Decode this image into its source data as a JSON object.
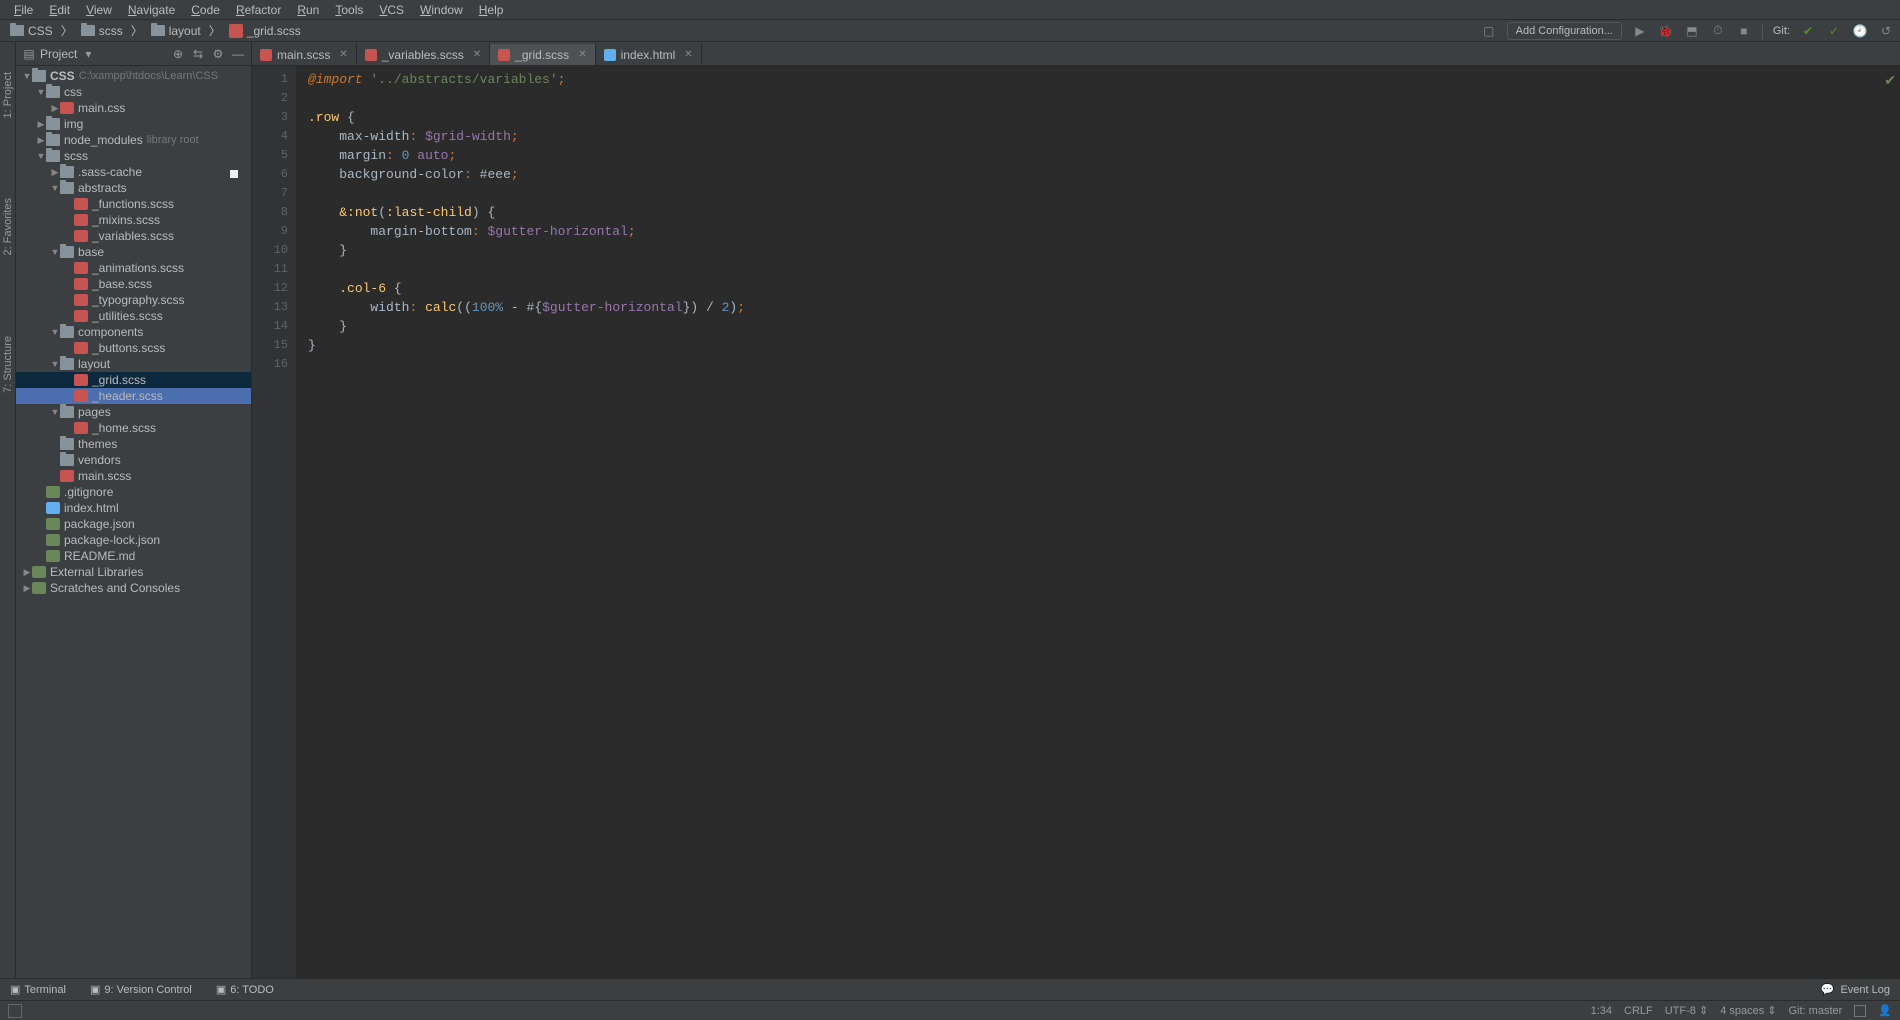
{
  "menu": [
    "File",
    "Edit",
    "View",
    "Navigate",
    "Code",
    "Refactor",
    "Run",
    "Tools",
    "VCS",
    "Window",
    "Help"
  ],
  "breadcrumb": [
    {
      "icon": "folder",
      "label": "CSS"
    },
    {
      "icon": "folder",
      "label": "scss"
    },
    {
      "icon": "folder",
      "label": "layout"
    },
    {
      "icon": "scss",
      "label": "_grid.scss"
    }
  ],
  "run_config": {
    "add": "Add Configuration..."
  },
  "vcs_label": "Git:",
  "sidebar": {
    "title": "Project",
    "tree": [
      {
        "d": 0,
        "arrow": "▼",
        "icon": "folder",
        "label": "CSS",
        "suffix": "C:\\xampp\\htdocs\\Learn\\CSS",
        "bold": true
      },
      {
        "d": 1,
        "arrow": "▼",
        "icon": "folder",
        "label": "css"
      },
      {
        "d": 2,
        "arrow": "▶",
        "icon": "css",
        "label": "main.css"
      },
      {
        "d": 1,
        "arrow": "▶",
        "icon": "folder",
        "label": "img"
      },
      {
        "d": 1,
        "arrow": "▶",
        "icon": "folder",
        "label": "node_modules",
        "suffix": "library root"
      },
      {
        "d": 1,
        "arrow": "▼",
        "icon": "folder",
        "label": "scss"
      },
      {
        "d": 2,
        "arrow": "▶",
        "icon": "folder",
        "label": ".sass-cache"
      },
      {
        "d": 2,
        "arrow": "▼",
        "icon": "folder",
        "label": "abstracts"
      },
      {
        "d": 3,
        "arrow": "",
        "icon": "scss",
        "label": "_functions.scss"
      },
      {
        "d": 3,
        "arrow": "",
        "icon": "scss",
        "label": "_mixins.scss"
      },
      {
        "d": 3,
        "arrow": "",
        "icon": "scss",
        "label": "_variables.scss"
      },
      {
        "d": 2,
        "arrow": "▼",
        "icon": "folder",
        "label": "base"
      },
      {
        "d": 3,
        "arrow": "",
        "icon": "scss",
        "label": "_animations.scss"
      },
      {
        "d": 3,
        "arrow": "",
        "icon": "scss",
        "label": "_base.scss"
      },
      {
        "d": 3,
        "arrow": "",
        "icon": "scss",
        "label": "_typography.scss"
      },
      {
        "d": 3,
        "arrow": "",
        "icon": "scss",
        "label": "_utilities.scss"
      },
      {
        "d": 2,
        "arrow": "▼",
        "icon": "folder",
        "label": "components"
      },
      {
        "d": 3,
        "arrow": "",
        "icon": "scss",
        "label": "_buttons.scss"
      },
      {
        "d": 2,
        "arrow": "▼",
        "icon": "folder",
        "label": "layout"
      },
      {
        "d": 3,
        "arrow": "",
        "icon": "scss",
        "label": "_grid.scss",
        "sel": true
      },
      {
        "d": 3,
        "arrow": "",
        "icon": "scss",
        "label": "_header.scss",
        "hov": true
      },
      {
        "d": 2,
        "arrow": "▼",
        "icon": "folder",
        "label": "pages"
      },
      {
        "d": 3,
        "arrow": "",
        "icon": "scss",
        "label": "_home.scss"
      },
      {
        "d": 2,
        "arrow": "",
        "icon": "folder",
        "label": "themes"
      },
      {
        "d": 2,
        "arrow": "",
        "icon": "folder",
        "label": "vendors"
      },
      {
        "d": 2,
        "arrow": "",
        "icon": "scss",
        "label": "main.scss"
      },
      {
        "d": 1,
        "arrow": "",
        "icon": "file",
        "label": ".gitignore"
      },
      {
        "d": 1,
        "arrow": "",
        "icon": "html",
        "label": "index.html"
      },
      {
        "d": 1,
        "arrow": "",
        "icon": "json",
        "label": "package.json"
      },
      {
        "d": 1,
        "arrow": "",
        "icon": "json",
        "label": "package-lock.json"
      },
      {
        "d": 1,
        "arrow": "",
        "icon": "md",
        "label": "README.md"
      },
      {
        "d": 0,
        "arrow": "▶",
        "icon": "lib",
        "label": "External Libraries"
      },
      {
        "d": 0,
        "arrow": "▶",
        "icon": "scratch",
        "label": "Scratches and Consoles"
      }
    ]
  },
  "left_tools": [
    "1: Project",
    "2: Favorites",
    "7: Structure"
  ],
  "tabs": [
    {
      "icon": "scss",
      "label": "main.scss",
      "active": false
    },
    {
      "icon": "scss",
      "label": "_variables.scss",
      "active": false
    },
    {
      "icon": "scss",
      "label": "_grid.scss",
      "active": true
    },
    {
      "icon": "html",
      "label": "index.html",
      "active": false
    }
  ],
  "code": {
    "lines": [
      {
        "n": 1,
        "html": "<span class='kw'>@import</span> <span class='str'>'../abstracts/variables'</span><span class='punc'>;</span>"
      },
      {
        "n": 2,
        "html": ""
      },
      {
        "n": 3,
        "html": "<span class='sel-css'>.row</span> {"
      },
      {
        "n": 4,
        "html": "    <span class='prop'>max-width</span><span class='punc'>:</span> <span class='var'>$grid-width</span><span class='punc'>;</span>"
      },
      {
        "n": 5,
        "html": "    <span class='prop'>margin</span><span class='punc'>:</span> <span class='num'>0</span> <span class='val'>auto</span><span class='punc'>;</span>"
      },
      {
        "n": 6,
        "html": "    <span class='prop'>background-color</span><span class='punc'>:</span> <span class='colorhex'>#eee</span><span class='punc'>;</span>",
        "marker": true
      },
      {
        "n": 7,
        "html": ""
      },
      {
        "n": 8,
        "html": "    <span class='pseudo'>&:not</span>(<span class='pseudo'>:last-child</span>) {"
      },
      {
        "n": 9,
        "html": "        <span class='prop'>margin-bottom</span><span class='punc'>:</span> <span class='var'>$gutter-horizontal</span><span class='punc'>;</span>"
      },
      {
        "n": 10,
        "html": "    }"
      },
      {
        "n": 11,
        "html": ""
      },
      {
        "n": 12,
        "html": "    <span class='sel-css'>.col-6</span> {"
      },
      {
        "n": 13,
        "html": "        <span class='prop'>width</span><span class='punc'>:</span> <span class='fn'>calc</span>((<span class='num'>100%</span> - #{<span class='var'>$gutter-horizontal</span>}) / <span class='num'>2</span>)<span class='punc'>;</span>"
      },
      {
        "n": 14,
        "html": "    }"
      },
      {
        "n": 15,
        "html": "}"
      },
      {
        "n": 16,
        "html": ""
      }
    ]
  },
  "bottom_tools": [
    {
      "icon": "terminal",
      "label": "Terminal"
    },
    {
      "icon": "vcs",
      "label": "9: Version Control"
    },
    {
      "icon": "todo",
      "label": "6: TODO"
    }
  ],
  "event_log": "Event Log",
  "status": {
    "pos": "1:34",
    "lineend": "CRLF",
    "encoding": "UTF-8",
    "indent": "4 spaces",
    "git": "Git: master"
  }
}
